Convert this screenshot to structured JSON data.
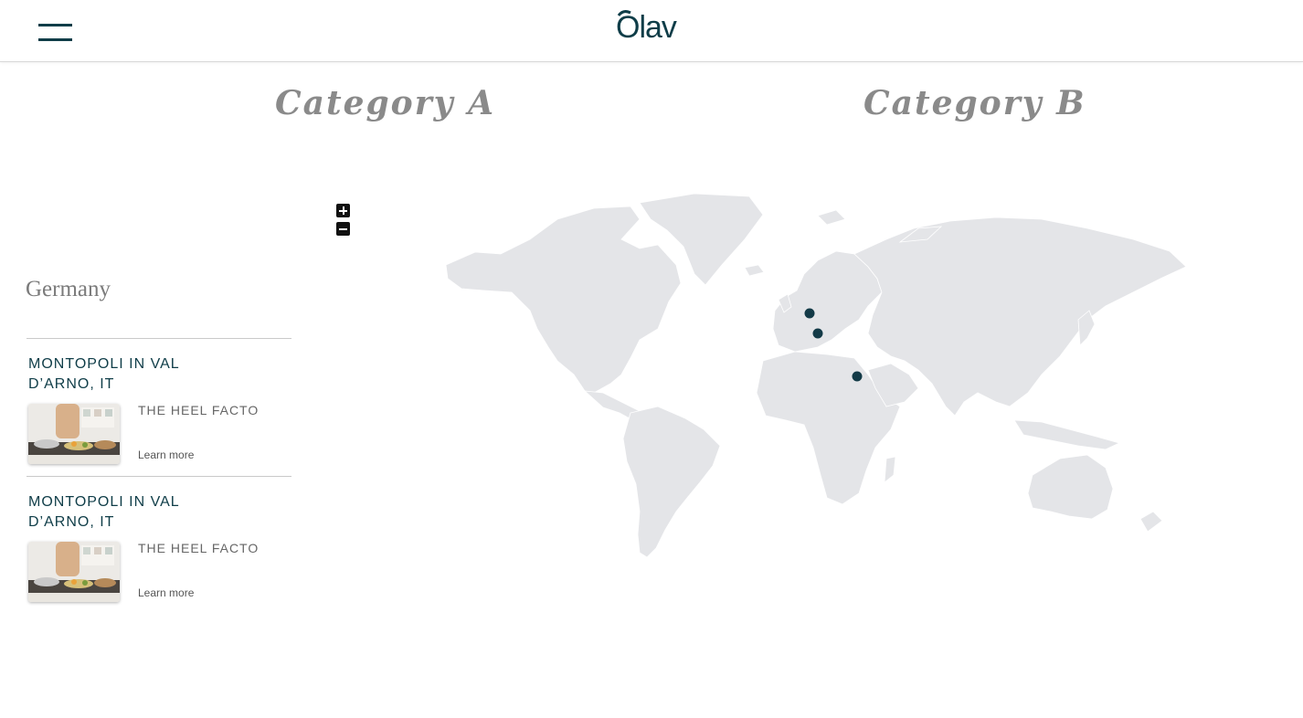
{
  "header": {
    "logo_text": "Olav",
    "menu_icon": "hamburger-menu-icon",
    "brand_color": "#0f3d48"
  },
  "categories": [
    {
      "label": "Category A"
    },
    {
      "label": "Category B"
    }
  ],
  "map_controls": {
    "zoom_in_icon": "plus-icon",
    "zoom_out_icon": "minus-icon"
  },
  "map": {
    "land_color": "#e4e5e8",
    "marker_color": "#133a47",
    "markers": [
      {
        "place": "Europe (north)"
      },
      {
        "place": "Europe (south)"
      },
      {
        "place": "Middle East"
      }
    ]
  },
  "sidebar": {
    "country": "Germany",
    "items": [
      {
        "location": "MONTOPOLI IN VAL D’ARNO, IT",
        "store": "THE HEEL FACTO",
        "link": "Learn more"
      },
      {
        "location": "MONTOPOLI IN VAL D’ARNO, IT",
        "store": "THE HEEL FACTO",
        "link": "Learn more"
      }
    ]
  }
}
